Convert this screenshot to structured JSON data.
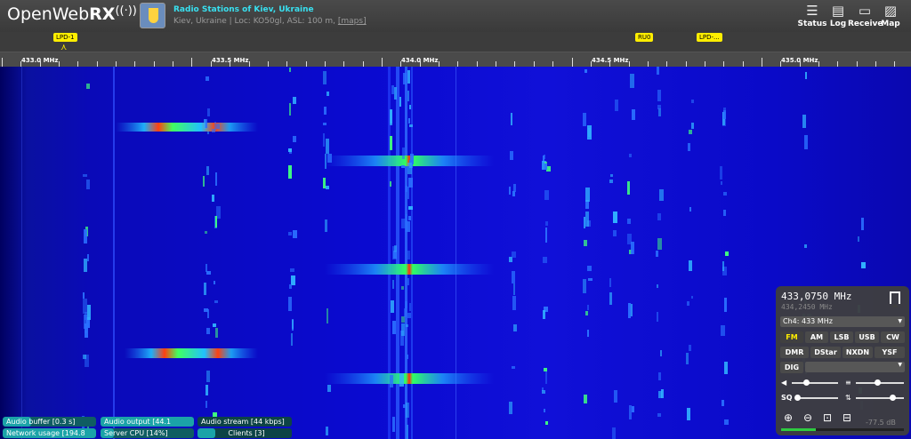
{
  "header": {
    "logo_text": "OpenWeb",
    "logo_bold": "RX",
    "logo_symbol": "((·))",
    "receiver_title": "Radio Stations of Kiev, Ukraine",
    "receiver_desc": "Kiev, Ukraine | Loc: KO50gl, ASL: 100 m, ",
    "maps_link": "[maps]",
    "buttons": [
      {
        "label": "Status",
        "icon": "status-icon"
      },
      {
        "label": "Log",
        "icon": "log-icon"
      },
      {
        "label": "Receive",
        "icon": "receive-icon"
      },
      {
        "label": "Map",
        "icon": "map-icon"
      }
    ]
  },
  "bookmarks": [
    {
      "label": "LPD-1"
    },
    {
      "label": "RU0"
    },
    {
      "label": "LPD-..."
    }
  ],
  "scale": {
    "labels": [
      "433.0 MHz",
      "433.5 MHz",
      "434.0 MHz",
      "434.5 MHz",
      "435.0 MHz"
    ]
  },
  "status": {
    "audio_buffer": "Audio buffer [0.3 s]",
    "audio_output": "Audio output [44.1",
    "audio_stream": "Audio stream [44 kbps]",
    "network_usage": "Network usage [194.8",
    "server_cpu": "Server CPU [14%]",
    "clients": "Clients [3]",
    "audio_buffer_level": 0.3,
    "server_cpu_level": 0.14
  },
  "panel": {
    "frequency": "433,0750 MHz",
    "offset_frequency": "434,2450 MHz",
    "channel": "Ch4: 433 MHz",
    "modes_row1": [
      "FM",
      "AM",
      "LSB",
      "USB",
      "CW"
    ],
    "modes_row2": [
      "DMR",
      "DStar",
      "NXDN",
      "YSF"
    ],
    "dig_label": "DIG",
    "active_mode": "FM",
    "db_value": "-77.5 dB",
    "volume_level": 0.3,
    "squelch_level": 0.05,
    "nr_level": 0.45,
    "gain_level": 0.75,
    "meter_level": 0.28
  },
  "colors": {
    "accent_cyan": "#38e0f0",
    "bookmark_yellow": "#ffee00",
    "status_teal": "#1ba3a8"
  }
}
